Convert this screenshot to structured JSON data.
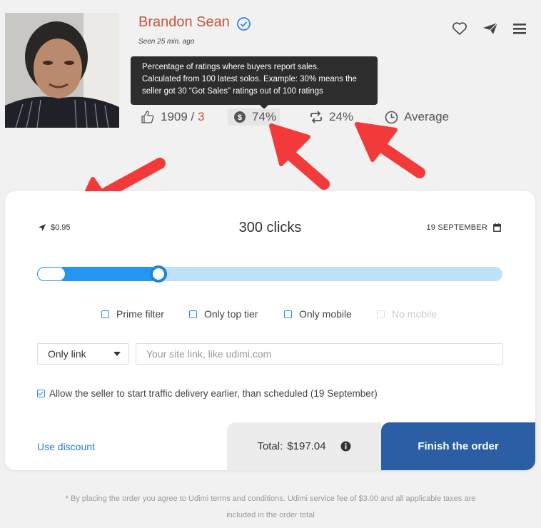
{
  "seller": {
    "name": "Brandon Sean",
    "seen": "Seen 25 min. ago"
  },
  "tooltip": {
    "lines": [
      "Percentage of ratings where buyers report sales.",
      "Calculated from 100 latest solos. Example: 30% means the",
      "seller got 30 “Got Sales” ratings out of 100 ratings"
    ]
  },
  "stats": {
    "likes": "1909",
    "separator": " / ",
    "dislikes": "3",
    "sales": "74%",
    "repeat": "24%",
    "speed": "Average"
  },
  "order": {
    "price": "$0.95",
    "clicks": "300 clicks",
    "date": "19 SEPTEMBER",
    "slider_fraction": 0.27
  },
  "filters": [
    {
      "label": "Prime filter",
      "checked": false,
      "disabled": false
    },
    {
      "label": "Only top tier",
      "checked": false,
      "disabled": false
    },
    {
      "label": "Only mobile",
      "checked": false,
      "disabled": false
    },
    {
      "label": "No mobile",
      "checked": false,
      "disabled": true
    }
  ],
  "link": {
    "type_selected": "Only link",
    "placeholder": "Your site link, like udimi.com"
  },
  "allow_early": {
    "checked": true,
    "label": "Allow the seller to start traffic delivery earlier, than scheduled (19 September)"
  },
  "footer": {
    "discount": "Use discount",
    "total_label": "Total:",
    "total_value": "$197.04",
    "finish": "Finish the order",
    "note_line1": "* By placing the order you agree to Udimi terms and conditions. Udimi service fee of $3.00 and all applicable taxes are",
    "note_line2": "included in the order total"
  },
  "colors": {
    "accent": "#2196f3",
    "name": "#c8553d",
    "finish": "#2b5ea4",
    "arrow": "#f23a3a"
  }
}
